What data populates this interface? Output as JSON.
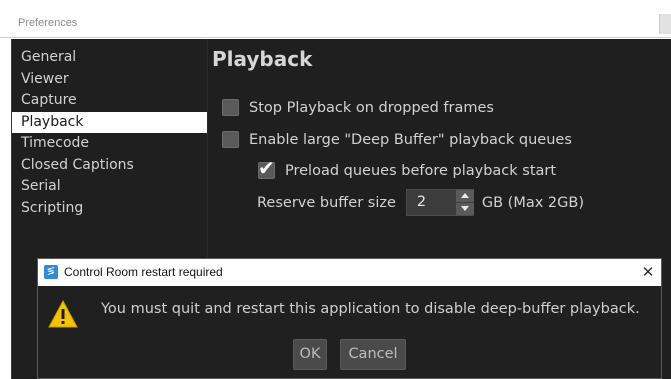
{
  "window": {
    "title": "Preferences"
  },
  "sidebar": {
    "items": [
      {
        "label": "General"
      },
      {
        "label": "Viewer"
      },
      {
        "label": "Capture"
      },
      {
        "label": "Playback"
      },
      {
        "label": "Timecode"
      },
      {
        "label": "Closed Captions"
      },
      {
        "label": "Serial"
      },
      {
        "label": "Scripting"
      }
    ],
    "selected": "Playback"
  },
  "playback": {
    "title": "Playback",
    "options": [
      {
        "label": "Stop Playback on dropped frames",
        "checked": false
      },
      {
        "label": "Enable large \"Deep Buffer\" playback queues",
        "checked": false
      },
      {
        "label": "Preload queues before playback start",
        "checked": true
      }
    ],
    "reserve_buffer": {
      "label": "Reserve buffer size",
      "value": "2",
      "unit": "GB (Max 2GB)"
    }
  },
  "dialog": {
    "title": "Control Room restart required",
    "app_icon": "control-room-app-icon",
    "icon": "warning-icon",
    "message": "You must quit and restart this application to disable deep-buffer playback.",
    "ok_label": "OK",
    "cancel_label": "Cancel"
  },
  "colors": {
    "panel_background": "#1f1f1f",
    "selected_item_background": "#ffffff",
    "warning_yellow": "#f5c400",
    "app_icon_blue": "#2f8bd6"
  }
}
